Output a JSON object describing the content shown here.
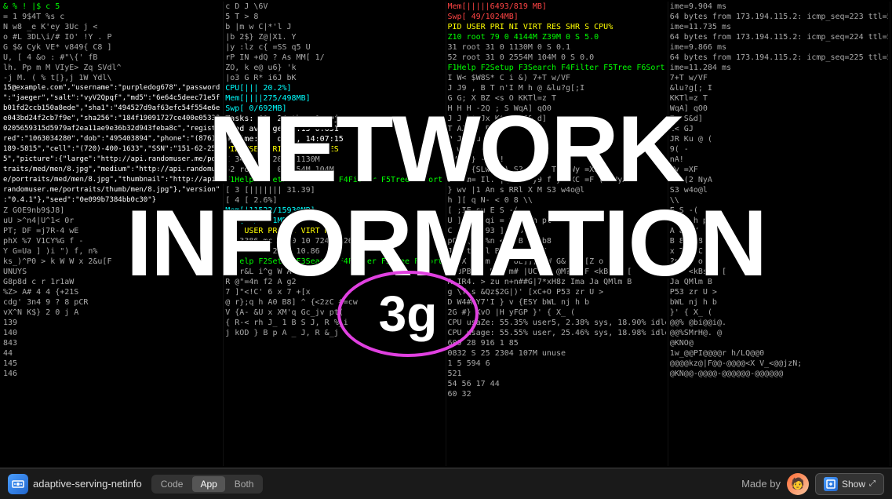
{
  "app": {
    "name": "adaptive-serving-netinfo",
    "icon": "network-icon"
  },
  "tabs": [
    {
      "label": "Code",
      "id": "code",
      "active": false
    },
    {
      "label": "App",
      "id": "app",
      "active": true
    },
    {
      "label": "Both",
      "id": "both",
      "active": false
    }
  ],
  "overlay": {
    "line1": "NETWORK",
    "line2": "INFORMATION",
    "badge": "3g"
  },
  "footer": {
    "made_by": "Made by",
    "show_label": "Show"
  },
  "terminal_lines": {
    "col1": [
      "15@example.com\",\"username\":\"purpledog678\",\"password",
      "\":\"jaeger\",\"salt\":\"vyV2Qpqf\",\"md5\":\"6e64c5deec71e5f",
      "b01fd2ccb150a8ede\",\"sha1\":\"494527d9af63efc54f554e6e",
      "e043bd24f2cb7f9e\",\"sha256\":\"184f19091727ce400e05338",
      "0205659315d5979af2ea11ae9e36b32d943feba8c\",\"registe",
      "red\":\"1063034280\",\"dob\":\"495403894\",\"phone\":\"(876)-",
      "189-5815\",\"cell\":\"(720)-400-1633\",\"SSN\":\"151-62-258",
      "5\",\"picture\":{\"large\":\"http://api.randomuser.me/por",
      "traits/med/men/8.jpg\",\"medium\":\"http://api.randomu",
      "e/portraits/med/men/8.jpg\",\"thumbnail\":\"http://api.",
      "randomuser.me/portraits/thumb/men/8.jpg\"},\"version\"",
      ":\"0.4.1\"},\"seed\":\"0e099b7384bb0c30\"}"
    ],
    "col2": [
      "CPU[||| 20.2%]",
      "Mem[||||275/498MB]",
      "Swp[ 0/692MB]",
      "",
      "Tasks: 60, 24 thr; 1 ruj",
      "Load average: 1.15 0.651",
      "Uptime: 42 days, 14:07:15",
      "",
      "PID USER PRI NI VIRT RES",
      "XI 3386 mc 20 0 10 7243M 26144",
      "I  3427 mc 20 0 1130M",
      "52 root 31 0 2554M 104M",
      "",
      "3 [||||||| 31.39]",
      "4 [ 2.6%]",
      "Mem[11522/15930MB]",
      "Swp[ 0/7811MB]",
      "",
      "PID USER PRI NI VIRT RES",
      "XI 3386 mc 20 0 10 7243M 26144",
      "I  3427 mc 20 0 10.86"
    ],
    "col3": [
      "Mem[|||||6493/819 MB]",
      "Swp[ 49/1024MB]",
      "",
      "PID USER PRI NI VIRT RES SHR S CPU%",
      "Z10 root 79 0 4144M Z39M 0 S 5.0",
      "31 root 31 0 1130M 0 S 0.1",
      "52 root 31 0 2554M 104M 0 S 0.0",
      "",
      "F1Help F2Setup F3Search F4Filter F5Tree F6Sort"
    ],
    "col4": [
      "ime=9.904 ms",
      "64 bytes from 173.194.115.2: icmp_seq=223 ttl=57 t",
      "ime=11.735 ms",
      "64 bytes from 173.194.115.2: icmp_seq=224 ttl=57 t",
      "ime=9.866 ms",
      "64 bytes from 173.194.115.2: icmp_seq=225 ttl=57 t",
      "ime=11.284 ms"
    ]
  },
  "bottom_lines": [
    "139",
    "140",
    "843",
    "44",
    "145",
    "146"
  ]
}
